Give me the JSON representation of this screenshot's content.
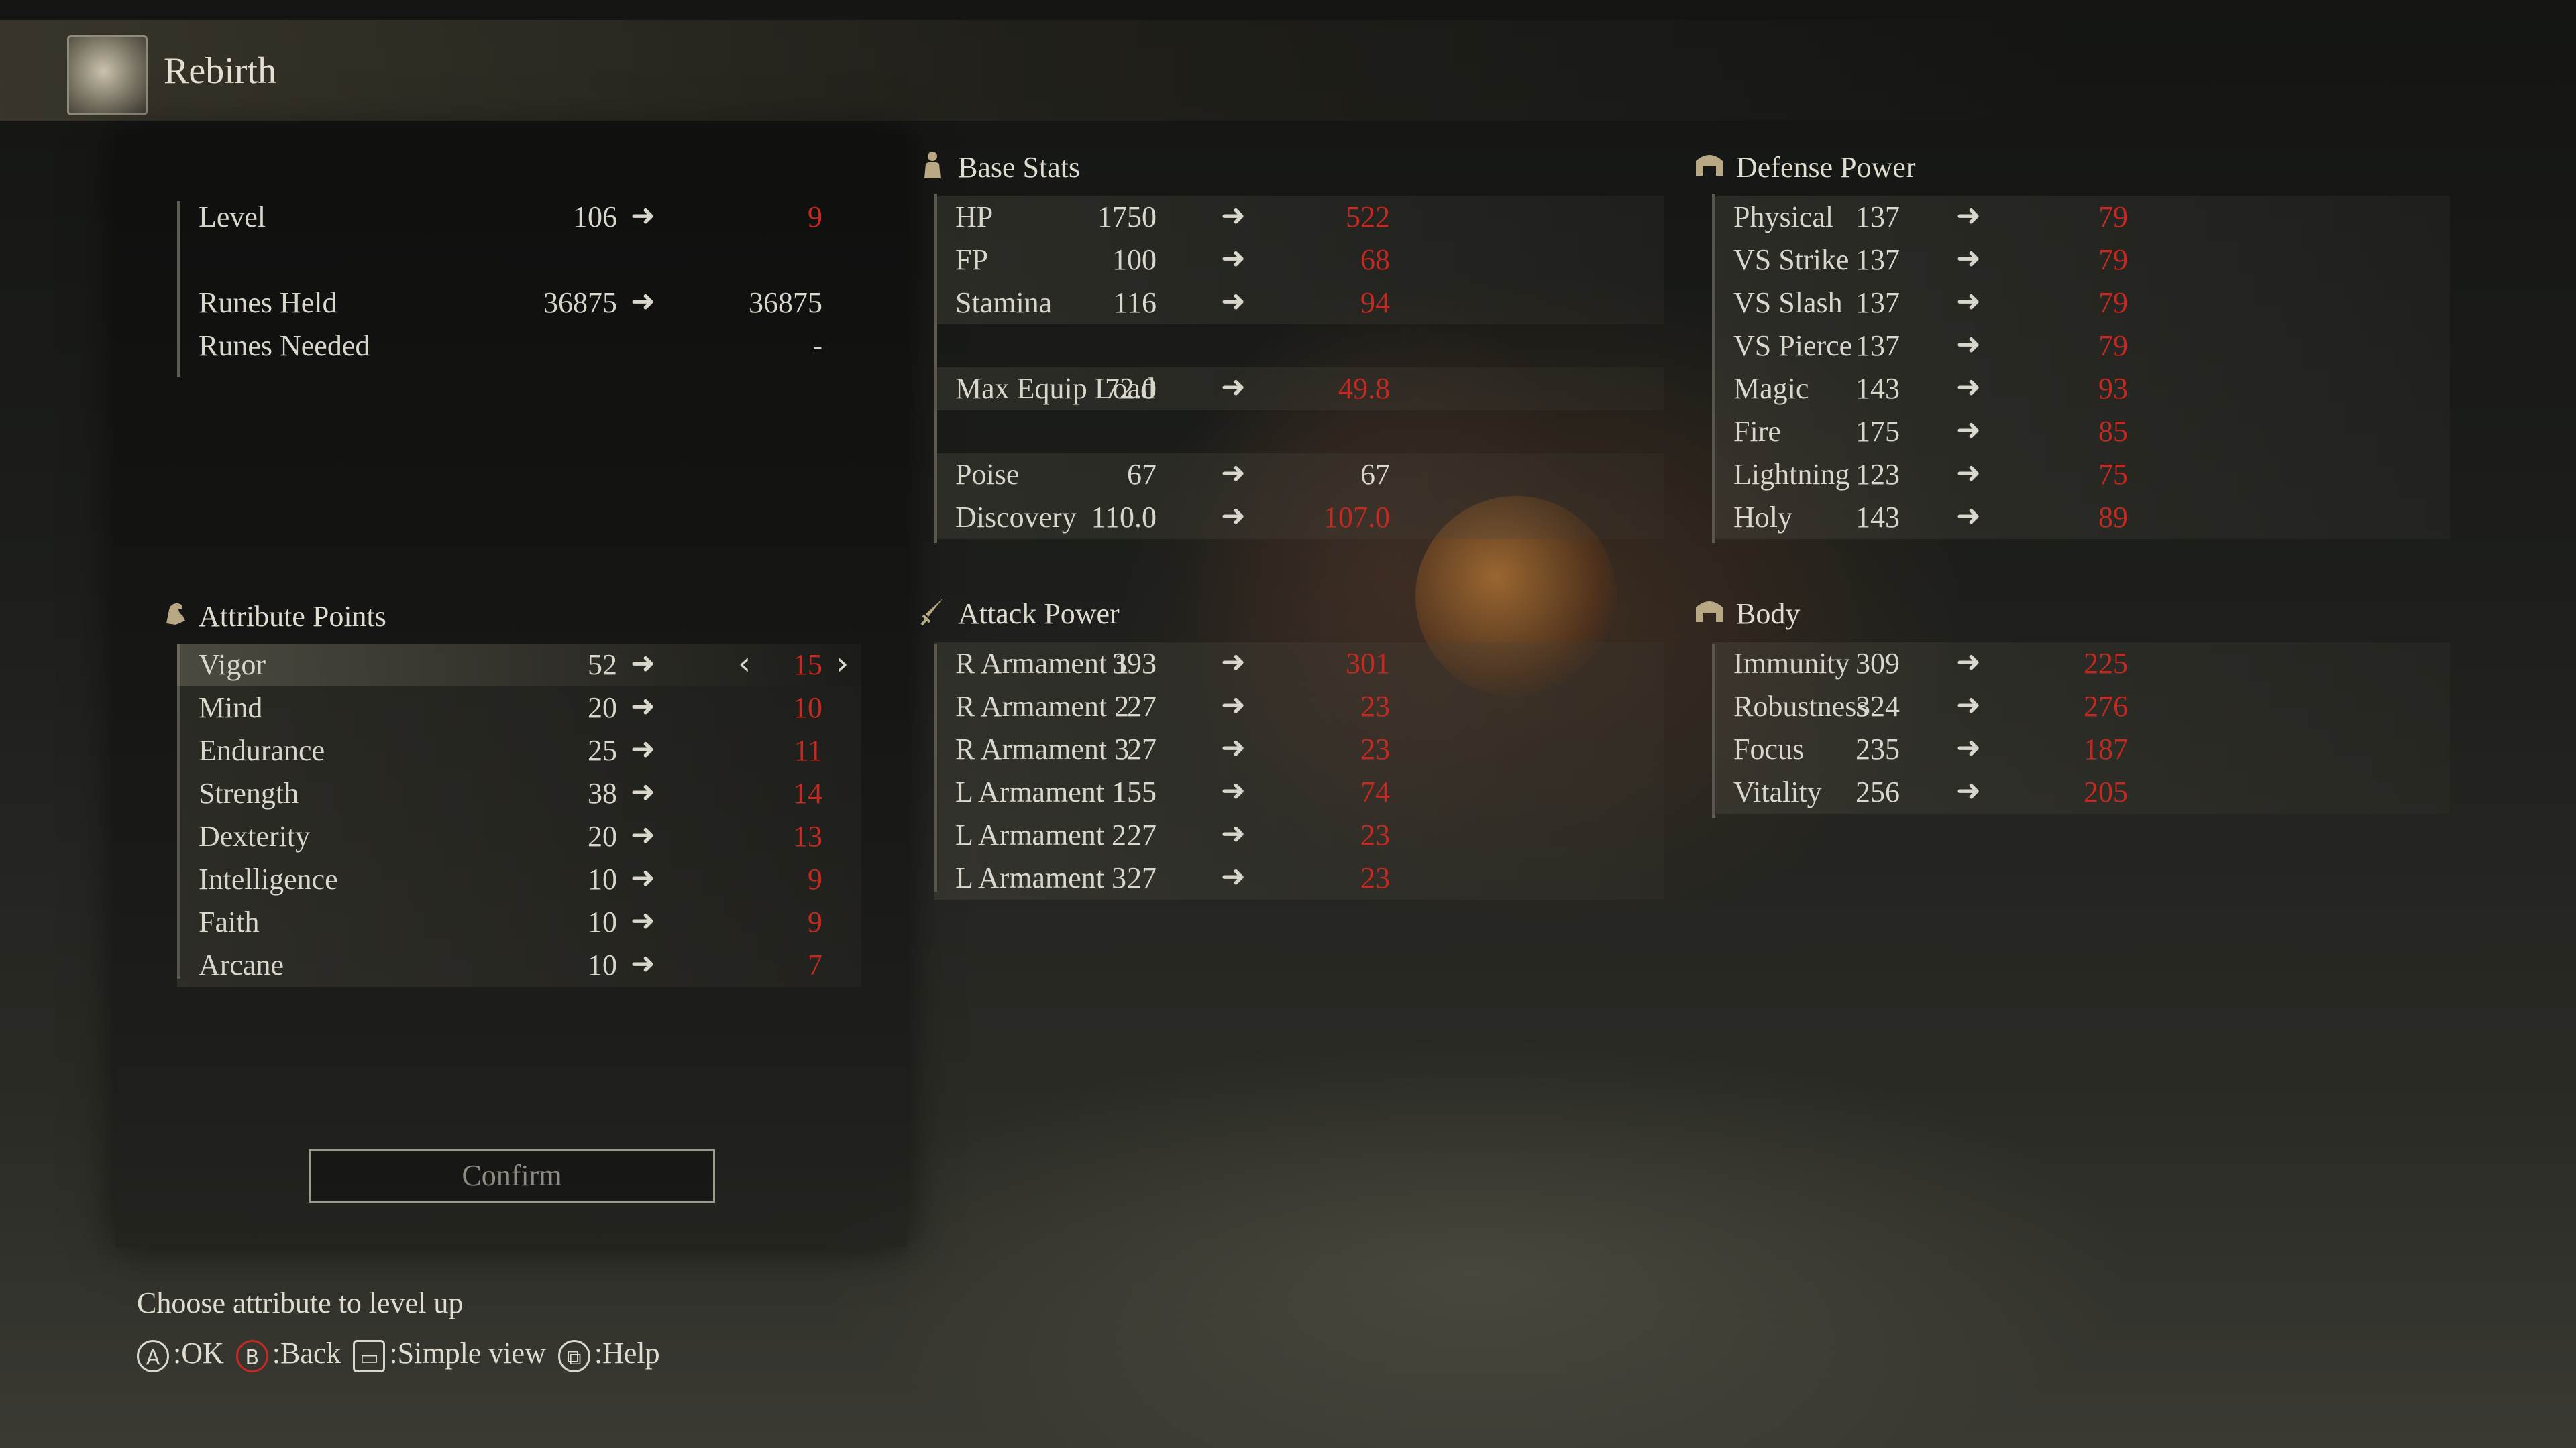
{
  "header": {
    "title": "Rebirth",
    "icon": "rune-orb-icon"
  },
  "summary": [
    {
      "label": "Level",
      "value": "106",
      "new": "9",
      "new_color": "red"
    },
    {
      "label": "Runes Held",
      "value": "36875",
      "new": "36875",
      "new_color": "white"
    },
    {
      "label": "Runes Needed",
      "value": "",
      "new": "-",
      "new_color": "white"
    }
  ],
  "attributes": {
    "title": "Attribute Points",
    "items": [
      {
        "label": "Vigor",
        "value": "52",
        "new": "15"
      },
      {
        "label": "Mind",
        "value": "20",
        "new": "10"
      },
      {
        "label": "Endurance",
        "value": "25",
        "new": "11"
      },
      {
        "label": "Strength",
        "value": "38",
        "new": "14"
      },
      {
        "label": "Dexterity",
        "value": "20",
        "new": "13"
      },
      {
        "label": "Intelligence",
        "value": "10",
        "new": "9"
      },
      {
        "label": "Faith",
        "value": "10",
        "new": "9"
      },
      {
        "label": "Arcane",
        "value": "10",
        "new": "7"
      }
    ]
  },
  "base_stats": {
    "title": "Base Stats",
    "items": [
      {
        "label": "HP",
        "value": "1750",
        "new": "522",
        "new_color": "red"
      },
      {
        "label": "FP",
        "value": "100",
        "new": "68",
        "new_color": "red"
      },
      {
        "label": "Stamina",
        "value": "116",
        "new": "94",
        "new_color": "red"
      },
      {
        "label": "Max Equip Load",
        "value": "72.0",
        "new": "49.8",
        "new_color": "red"
      },
      {
        "label": "Poise",
        "value": "67",
        "new": "67",
        "new_color": "white"
      },
      {
        "label": "Discovery",
        "value": "110.0",
        "new": "107.0",
        "new_color": "red"
      }
    ]
  },
  "attack_power": {
    "title": "Attack Power",
    "items": [
      {
        "label": "R Armament 1",
        "value": "393",
        "new": "301"
      },
      {
        "label": "R Armament 2",
        "value": "27",
        "new": "23"
      },
      {
        "label": "R Armament 3",
        "value": "27",
        "new": "23"
      },
      {
        "label": "L Armament 1",
        "value": "155",
        "new": "74"
      },
      {
        "label": "L Armament 2",
        "value": "27",
        "new": "23"
      },
      {
        "label": "L Armament 3",
        "value": "27",
        "new": "23"
      }
    ]
  },
  "defense_power": {
    "title": "Defense Power",
    "items": [
      {
        "label": "Physical",
        "value": "137",
        "new": "79"
      },
      {
        "label": "VS Strike",
        "value": "137",
        "new": "79"
      },
      {
        "label": "VS Slash",
        "value": "137",
        "new": "79"
      },
      {
        "label": "VS Pierce",
        "value": "137",
        "new": "79"
      },
      {
        "label": "Magic",
        "value": "143",
        "new": "93"
      },
      {
        "label": "Fire",
        "value": "175",
        "new": "85"
      },
      {
        "label": "Lightning",
        "value": "123",
        "new": "75"
      },
      {
        "label": "Holy",
        "value": "143",
        "new": "89"
      }
    ]
  },
  "body": {
    "title": "Body",
    "items": [
      {
        "label": "Immunity",
        "value": "309",
        "new": "225"
      },
      {
        "label": "Robustness",
        "value": "324",
        "new": "276"
      },
      {
        "label": "Focus",
        "value": "235",
        "new": "187"
      },
      {
        "label": "Vitality",
        "value": "256",
        "new": "205"
      }
    ]
  },
  "confirm_label": "Confirm",
  "hint": "Choose attribute to level up",
  "controls": [
    {
      "button": "A",
      "label": ":OK",
      "icon": "a-button-icon"
    },
    {
      "button": "B",
      "label": ":Back",
      "icon": "b-button-icon"
    },
    {
      "button": "",
      "label": ":Simple view",
      "icon": "touchpad-icon"
    },
    {
      "button": "",
      "label": ":Help",
      "icon": "view-button-icon"
    }
  ],
  "colors": {
    "red": "#c42a22",
    "text": "#d9d6cc",
    "arrow": "#d9d6cc"
  },
  "arrow_glyph": "➜",
  "chevron_left": "‹",
  "chevron_right": "›"
}
